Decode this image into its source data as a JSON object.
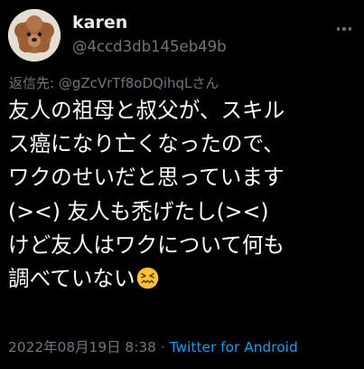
{
  "author": {
    "display_name": "karen",
    "handle": "@4ccd3db145eb49b",
    "avatar_icon": "dog-avatar-icon"
  },
  "reply": {
    "text": "返信先: @gZcVrTf8oDQihqLさん"
  },
  "tweet": {
    "lines": [
      "友人の祖母と叔父が、スキル",
      "ス癌になり亡くなったので、",
      "ワクのせいだと思っています",
      "(><)  友人も禿げたし(><)",
      "けど友人はワクについて何も",
      "調べていない"
    ],
    "trailing_emoji": "confounded-face-emoji"
  },
  "meta": {
    "timestamp": "2022年08月19日 8:38",
    "separator": "·",
    "source": "Twitter for Android"
  },
  "colors": {
    "background": "#000000",
    "text": "#ffffff",
    "secondary": "#71767b",
    "link": "#1d9bf0",
    "emoji": "#f9c22e"
  }
}
